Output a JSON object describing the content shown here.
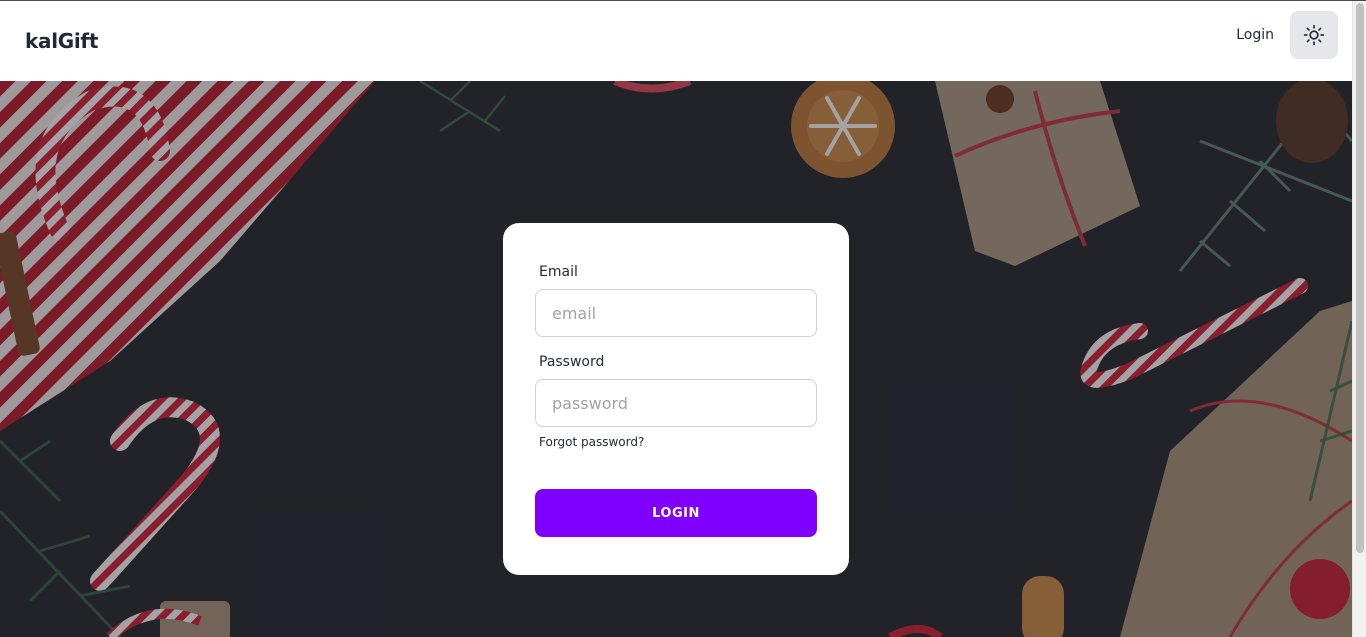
{
  "brand": {
    "name": "kalGift"
  },
  "nav": {
    "login_label": "Login",
    "theme_icon": "sun-icon"
  },
  "form": {
    "email_label": "Email",
    "email_placeholder": "email",
    "email_value": "",
    "password_label": "Password",
    "password_placeholder": "password",
    "password_value": "",
    "forgot_label": "Forgot password?",
    "submit_label": "LOGIN"
  },
  "colors": {
    "accent": "#7f00ff",
    "hero_bg": "#2a2b31",
    "card_bg": "#ffffff",
    "theme_button_bg": "#e5e7eb"
  }
}
